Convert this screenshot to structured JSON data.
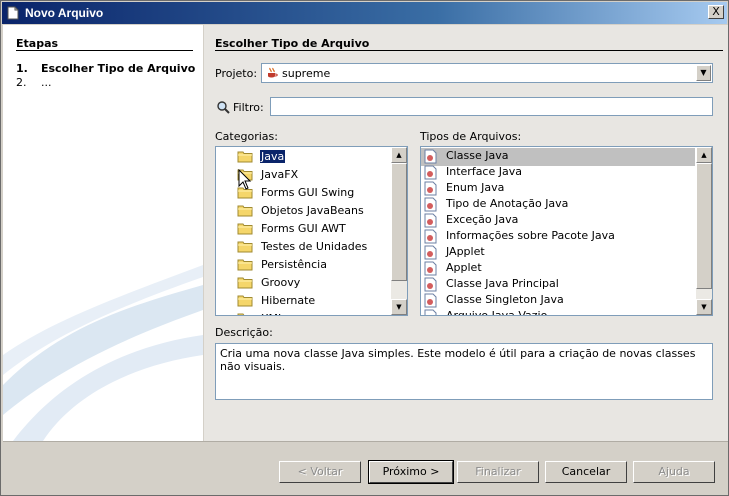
{
  "window": {
    "title": "Novo Arquivo",
    "close_glyph": "X"
  },
  "steps": {
    "title": "Etapas",
    "items": [
      {
        "num": "1.",
        "label": "Escolher Tipo de Arquivo",
        "active": true
      },
      {
        "num": "2.",
        "label": "...",
        "active": false
      }
    ]
  },
  "main": {
    "title": "Escolher Tipo de Arquivo",
    "project_label": "Projeto:",
    "project_value": "supreme",
    "filter_label": "Filtro:",
    "filter_value": "",
    "categories_label": "Categorias:",
    "file_types_label": "Tipos de Arquivos:",
    "description_label": "Descrição:",
    "description_text": "Cria uma nova classe Java simples. Este modelo é útil para a criação de novas classes não visuais."
  },
  "categories": [
    {
      "label": "Java",
      "selected": true
    },
    {
      "label": "JavaFX",
      "selected": false
    },
    {
      "label": "Forms GUI Swing",
      "selected": false
    },
    {
      "label": "Objetos JavaBeans",
      "selected": false
    },
    {
      "label": "Forms GUI AWT",
      "selected": false
    },
    {
      "label": "Testes de Unidades",
      "selected": false
    },
    {
      "label": "Persistência",
      "selected": false
    },
    {
      "label": "Groovy",
      "selected": false
    },
    {
      "label": "Hibernate",
      "selected": false
    },
    {
      "label": "XML",
      "selected": false
    }
  ],
  "file_types": [
    {
      "label": "Classe Java",
      "selected": true
    },
    {
      "label": "Interface Java",
      "selected": false
    },
    {
      "label": "Enum Java",
      "selected": false
    },
    {
      "label": "Tipo de Anotação Java",
      "selected": false
    },
    {
      "label": "Exceção Java",
      "selected": false
    },
    {
      "label": "Informações sobre Pacote Java",
      "selected": false
    },
    {
      "label": "JApplet",
      "selected": false
    },
    {
      "label": "Applet",
      "selected": false
    },
    {
      "label": "Classe Java Principal",
      "selected": false
    },
    {
      "label": "Classe Singleton Java",
      "selected": false
    },
    {
      "label": "Arquivo Java Vazio",
      "selected": false
    }
  ],
  "buttons": {
    "back": "< Voltar",
    "next": "Próximo >",
    "finish": "Finalizar",
    "cancel": "Cancelar",
    "help": "Ajuda"
  },
  "colors": {
    "title_bar_start": "#0a246a",
    "selection": "#0a246a",
    "list_selection": "#c0c0c0",
    "folder": "#f5d66a"
  },
  "icons": {
    "app": "document-icon",
    "project": "java-cup-icon",
    "filter": "magnifier-icon",
    "category": "folder-icon",
    "file_type": "java-file-icon"
  }
}
